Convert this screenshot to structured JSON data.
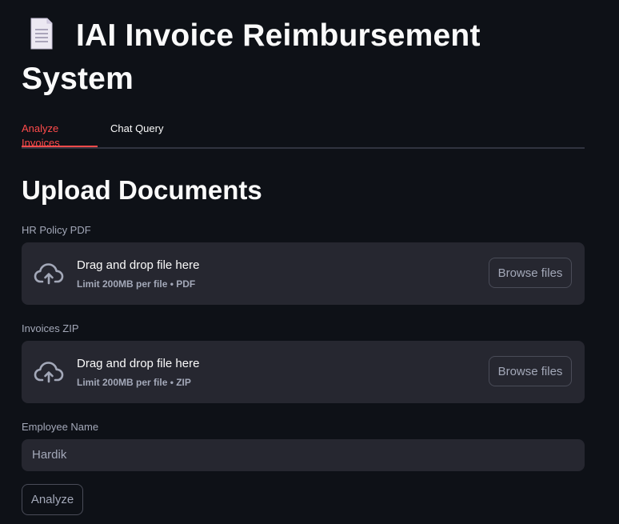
{
  "header": {
    "title": "IAI Invoice Reimbursement System",
    "title_icon": "page-facing-up-icon"
  },
  "tabs": [
    {
      "label": "Analyze Invoices",
      "active": true
    },
    {
      "label": "Chat Query",
      "active": false
    }
  ],
  "upload_section": {
    "title": "Upload Documents",
    "policy_uploader": {
      "label": "HR Policy PDF",
      "drop_text": "Drag and drop file here",
      "limit_text": "Limit 200MB per file • PDF",
      "browse_label": "Browse files",
      "icon": "cloud-upload-icon"
    },
    "invoices_uploader": {
      "label": "Invoices ZIP",
      "drop_text": "Drag and drop file here",
      "limit_text": "Limit 200MB per file • ZIP",
      "browse_label": "Browse files",
      "icon": "cloud-upload-icon"
    },
    "employee": {
      "label": "Employee Name",
      "value": "Hardik"
    },
    "analyze_label": "Analyze"
  },
  "colors": {
    "background": "#0e1117",
    "surface": "#262730",
    "accent": "#ff4b4b",
    "text": "#fafafa",
    "muted_text": "#a3a8b8"
  }
}
